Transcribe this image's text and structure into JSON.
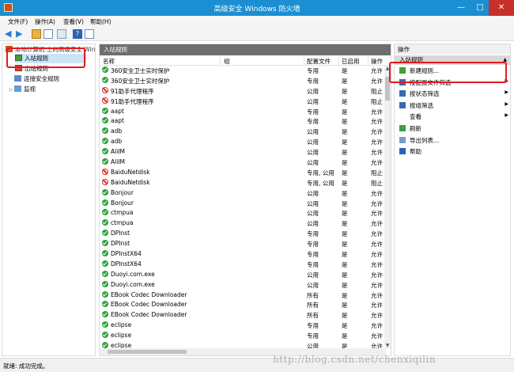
{
  "window": {
    "title": "高级安全 Windows 防火墙",
    "min": "—",
    "max": "□",
    "close": "✕"
  },
  "menu": [
    "文件(F)",
    "操作(A)",
    "查看(V)",
    "帮助(H)"
  ],
  "toolbar": {
    "back": "◀",
    "forward": "▶",
    "help": "?"
  },
  "tree": {
    "root": "本地计算机 上的高级安全 Win",
    "inbound": "入站规则",
    "outbound": "出站规则",
    "connection_security": "连接安全规则",
    "monitoring": "监视"
  },
  "center": {
    "header": "入站规则",
    "columns": [
      "名称",
      "组",
      "配置文件",
      "已启用",
      "操作"
    ],
    "rows": [
      {
        "name": "360安全卫士实时保护",
        "status": "allow",
        "profile": "专用",
        "enabled": "是",
        "action": "允许"
      },
      {
        "name": "360安全卫士实时保护",
        "status": "allow",
        "profile": "专用",
        "enabled": "是",
        "action": "允许"
      },
      {
        "name": "91助手代理程序",
        "status": "block",
        "profile": "公用",
        "enabled": "是",
        "action": "阻止"
      },
      {
        "name": "91助手代理程序",
        "status": "block",
        "profile": "公用",
        "enabled": "是",
        "action": "阻止"
      },
      {
        "name": "aapt",
        "status": "allow",
        "profile": "专用",
        "enabled": "是",
        "action": "允许"
      },
      {
        "name": "aapt",
        "status": "allow",
        "profile": "专用",
        "enabled": "是",
        "action": "允许"
      },
      {
        "name": "adb",
        "status": "allow",
        "profile": "公用",
        "enabled": "是",
        "action": "允许"
      },
      {
        "name": "adb",
        "status": "allow",
        "profile": "公用",
        "enabled": "是",
        "action": "允许"
      },
      {
        "name": "AliIM",
        "status": "allow",
        "profile": "公用",
        "enabled": "是",
        "action": "允许"
      },
      {
        "name": "AliIM",
        "status": "allow",
        "profile": "公用",
        "enabled": "是",
        "action": "允许"
      },
      {
        "name": "BaiduNetdisk",
        "status": "block",
        "profile": "专用, 公用",
        "enabled": "是",
        "action": "阻止"
      },
      {
        "name": "BaiduNetdisk",
        "status": "block",
        "profile": "专用, 公用",
        "enabled": "是",
        "action": "阻止"
      },
      {
        "name": "Bonjour",
        "status": "allow",
        "profile": "公用",
        "enabled": "是",
        "action": "允许"
      },
      {
        "name": "Bonjour",
        "status": "allow",
        "profile": "公用",
        "enabled": "是",
        "action": "允许"
      },
      {
        "name": "ctmpua",
        "status": "allow",
        "profile": "公用",
        "enabled": "是",
        "action": "允许"
      },
      {
        "name": "ctmpua",
        "status": "allow",
        "profile": "公用",
        "enabled": "是",
        "action": "允许"
      },
      {
        "name": "DPInst",
        "status": "allow",
        "profile": "专用",
        "enabled": "是",
        "action": "允许"
      },
      {
        "name": "DPInst",
        "status": "allow",
        "profile": "专用",
        "enabled": "是",
        "action": "允许"
      },
      {
        "name": "DPInstX64",
        "status": "allow",
        "profile": "专用",
        "enabled": "是",
        "action": "允许"
      },
      {
        "name": "DPInstX64",
        "status": "allow",
        "profile": "专用",
        "enabled": "是",
        "action": "允许"
      },
      {
        "name": "Duoyi.com.exe",
        "status": "allow",
        "profile": "公用",
        "enabled": "是",
        "action": "允许"
      },
      {
        "name": "Duoyi.com.exe",
        "status": "allow",
        "profile": "公用",
        "enabled": "是",
        "action": "允许"
      },
      {
        "name": "EBook Codec Downloader",
        "status": "allow",
        "profile": "所有",
        "enabled": "是",
        "action": "允许"
      },
      {
        "name": "EBook Codec Downloader",
        "status": "allow",
        "profile": "所有",
        "enabled": "是",
        "action": "允许"
      },
      {
        "name": "EBook Codec Downloader",
        "status": "allow",
        "profile": "所有",
        "enabled": "是",
        "action": "允许"
      },
      {
        "name": "eclipse",
        "status": "allow",
        "profile": "专用",
        "enabled": "是",
        "action": "允许"
      },
      {
        "name": "eclipse",
        "status": "allow",
        "profile": "专用",
        "enabled": "是",
        "action": "允许"
      },
      {
        "name": "eclipse",
        "status": "allow",
        "profile": "公用",
        "enabled": "是",
        "action": "允许"
      }
    ]
  },
  "actions": {
    "header": "操作",
    "section": "入站规则",
    "items": [
      {
        "label": "新建规则...",
        "icon": "new-rule-icon",
        "arrow": ""
      },
      {
        "label": "按配置文件筛选",
        "icon": "filter-icon",
        "arrow": "▶"
      },
      {
        "label": "按状态筛选",
        "icon": "filter-icon",
        "arrow": "▶"
      },
      {
        "label": "按组筛选",
        "icon": "filter-icon",
        "arrow": "▶"
      },
      {
        "label": "查看",
        "icon": "view-icon",
        "arrow": "▶"
      },
      {
        "label": "刷新",
        "icon": "refresh-icon",
        "arrow": ""
      },
      {
        "label": "导出列表...",
        "icon": "export-icon",
        "arrow": ""
      },
      {
        "label": "帮助",
        "icon": "help-icon",
        "arrow": ""
      }
    ]
  },
  "status": {
    "text": "就绪: 成功完成。"
  },
  "watermark": "http://blog.csdn.net/chenxiqilin",
  "colors": {
    "titlebar": "#1b8fd2",
    "highlight": "#e11b22",
    "allow": "#2da13a",
    "block": "#d22b2b"
  }
}
